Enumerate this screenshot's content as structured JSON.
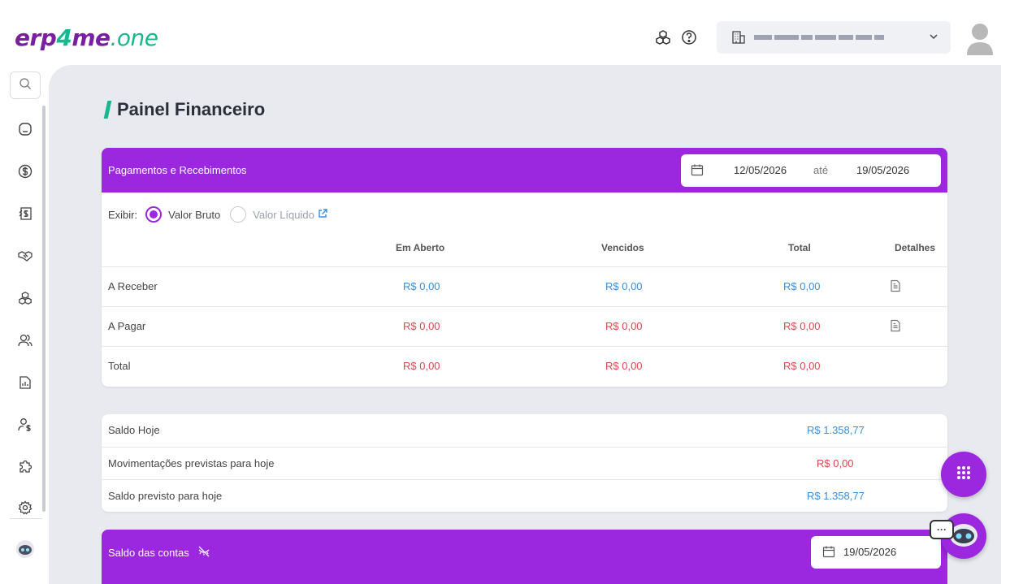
{
  "header": {
    "logo": {
      "part1": "erp",
      "part2": "4",
      "part3": "me",
      "part4": ".one"
    },
    "icons": [
      "modules-icon",
      "help-icon"
    ]
  },
  "sidebar": {
    "items": [
      "home-icon",
      "finance-icon",
      "cashflow-icon",
      "handshake-icon",
      "products-icon",
      "users-icon",
      "reports-icon",
      "user-dollar-icon",
      "puzzle-icon",
      "settings-icon",
      "robot-icon"
    ]
  },
  "page": {
    "title": "Painel Financeiro"
  },
  "pagamentos": {
    "title": "Pagamentos e Recebimentos",
    "date_from": "12/05/2026",
    "date_sep": "até",
    "date_to": "19/05/2026",
    "exibir_label": "Exibir:",
    "option_bruto": "Valor Bruto",
    "option_liquido": "Valor Líquido",
    "columns": [
      "Em Aberto",
      "Vencidos",
      "Total",
      "Detalhes"
    ],
    "rows": [
      {
        "label": "A Receber",
        "em_aberto": "R$ 0,00",
        "vencidos": "R$ 0,00",
        "total": "R$ 0,00"
      },
      {
        "label": "A Pagar",
        "em_aberto": "R$ 0,00",
        "vencidos": "R$ 0,00",
        "total": "R$ 0,00"
      },
      {
        "label": "Total",
        "em_aberto": "R$ 0,00",
        "vencidos": "R$ 0,00",
        "total": "R$ 0,00"
      }
    ]
  },
  "saldo": {
    "rows": [
      {
        "label": "Saldo Hoje",
        "value": "R$ 1.358,77"
      },
      {
        "label": "Movimentações previstas para hoje",
        "value": "R$ 0,00"
      },
      {
        "label": "Saldo previsto para hoje",
        "value": "R$ 1.358,77"
      }
    ]
  },
  "contas": {
    "title": "Saldo das contas",
    "date": "19/05/2026"
  },
  "fab": {
    "chat_bubble": "···"
  },
  "colors": {
    "accent": "#9b27df",
    "brand_green": "#17b890",
    "positive": "#3a8fd8",
    "negative": "#e0464e"
  }
}
